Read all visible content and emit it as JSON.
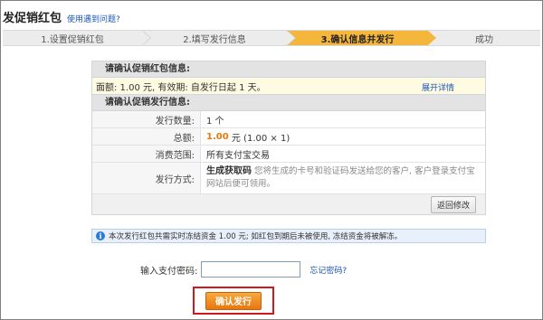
{
  "header": {
    "title": "发促销红包",
    "help_link": "使用遇到问题?"
  },
  "steps": [
    {
      "label": "1.设置促销红包"
    },
    {
      "label": "2.填写发行信息"
    },
    {
      "label": "3.确认信息并发行"
    },
    {
      "label": "成功"
    }
  ],
  "panel": {
    "red_packet_heading": "请确认促销红包信息:",
    "summary_text": "面额: 1.00 元, 有效期: 自发行日起 1 天。",
    "expand_link": "展开详情",
    "issue_heading": "请确认促销发行信息:",
    "rows": {
      "quantity": {
        "label": "发行数量:",
        "value": "1 个"
      },
      "total": {
        "label": "总额:",
        "amount": "1.00",
        "unit": "元 (1.00 × 1)"
      },
      "scope": {
        "label": "消费范围:",
        "value": "所有支付宝交易"
      },
      "method": {
        "label": "发行方式:",
        "name": "生成获取码",
        "desc": "您将生成的卡号和验证码发送给您的客户, 客户登录支付宝网站后便可领用。"
      }
    },
    "back_button": "返回修改"
  },
  "notice": {
    "icon": "info-icon",
    "text": "本次发行红包共需实时冻结资金 1.00 元; 如红包到期后未被使用, 冻结资金将被解冻。"
  },
  "password": {
    "label": "输入支付密码:",
    "value": "",
    "forgot_link": "忘记密码?"
  },
  "submit": {
    "label": "确认发行"
  },
  "colors": {
    "active_step": "#f5b63c",
    "link": "#1a55b8",
    "amount": "#e8790c",
    "highlight_border": "#d4161d"
  }
}
